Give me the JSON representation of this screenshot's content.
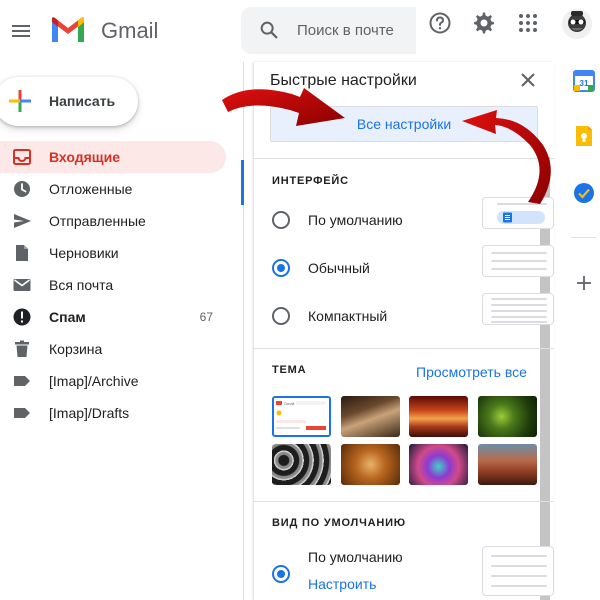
{
  "header": {
    "brand": "Gmail",
    "search_placeholder": "Поиск в почте",
    "menu_icon": "hamburger-menu-icon",
    "help_icon": "help-icon",
    "settings_icon": "gear-icon",
    "apps_icon": "apps-grid-icon"
  },
  "sidebar": {
    "compose_label": "Написать",
    "items": [
      {
        "label": "Входящие",
        "icon": "inbox-icon",
        "count": "",
        "active": true
      },
      {
        "label": "Отложенные",
        "icon": "clock-icon",
        "count": ""
      },
      {
        "label": "Отправленные",
        "icon": "send-icon",
        "count": ""
      },
      {
        "label": "Черновики",
        "icon": "draft-icon",
        "count": ""
      },
      {
        "label": "Вся почта",
        "icon": "mail-icon",
        "count": ""
      },
      {
        "label": "Спам",
        "icon": "spam-icon",
        "count": "67",
        "bold": true
      },
      {
        "label": "Корзина",
        "icon": "trash-icon",
        "count": ""
      },
      {
        "label": "[Imap]/Archive",
        "icon": "label-icon",
        "count": ""
      },
      {
        "label": "[Imap]/Drafts",
        "icon": "label-icon",
        "count": ""
      }
    ]
  },
  "quick_settings": {
    "title": "Быстрые настройки",
    "all_settings_label": "Все настройки",
    "density": {
      "title": "ИНТЕРФЕЙС",
      "options": [
        {
          "label": "По умолчанию",
          "selected": false
        },
        {
          "label": "Обычный",
          "selected": true
        },
        {
          "label": "Компактный",
          "selected": false
        }
      ]
    },
    "theme": {
      "title": "ТЕМА",
      "view_all_label": "Просмотреть все",
      "preview_brand": "Gmail"
    },
    "default_view": {
      "title": "ВИД ПО УМОЛЧАНИЮ",
      "option_label": "По умолчанию",
      "customize_label": "Настроить",
      "selected": true
    }
  },
  "rail": {
    "calendar_day": "31",
    "icons": [
      "calendar-icon",
      "keep-icon",
      "tasks-icon",
      "add-icon"
    ]
  },
  "colors": {
    "accent": "#1a73e8",
    "active_nav_bg": "#fce8e6",
    "active_nav_text": "#d93025",
    "annotation_arrow": "#b00000"
  }
}
